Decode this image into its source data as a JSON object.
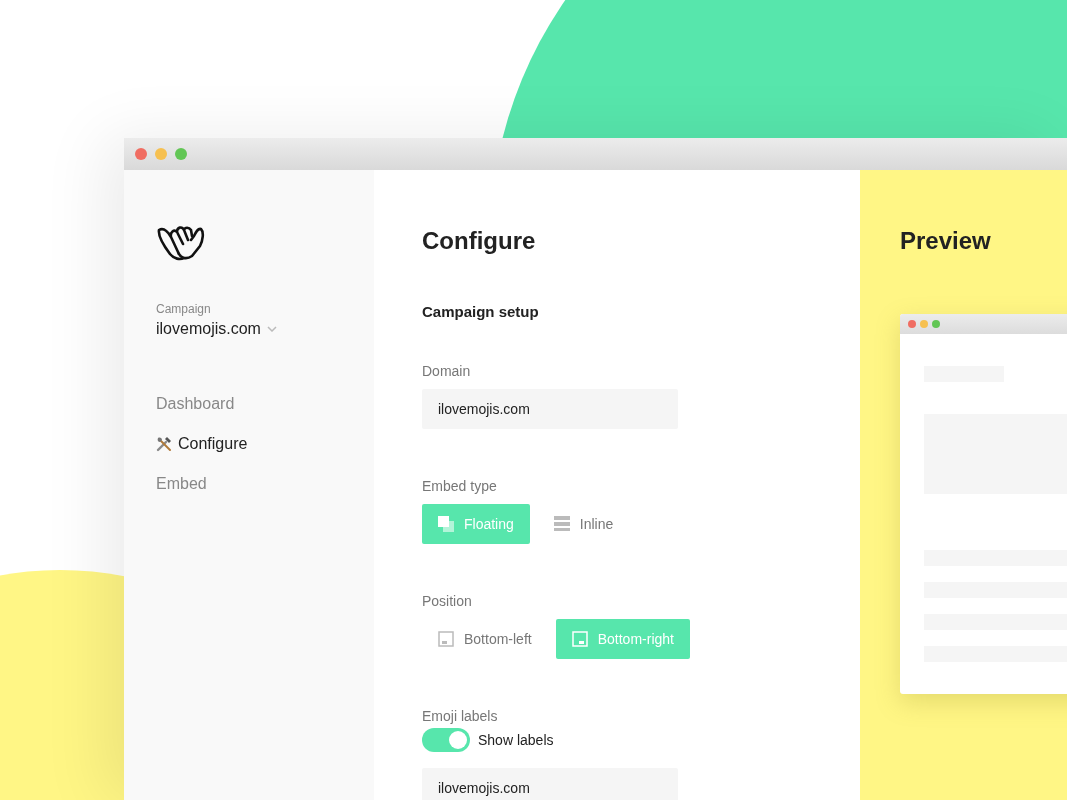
{
  "sidebar": {
    "campaign": {
      "label": "Campaign",
      "value": "ilovemojis.com"
    },
    "nav": [
      {
        "label": "Dashboard",
        "selected": false
      },
      {
        "label": "Configure",
        "selected": true
      },
      {
        "label": "Embed",
        "selected": false
      }
    ]
  },
  "configure": {
    "title": "Configure",
    "section_title": "Campaign setup",
    "domain": {
      "label": "Domain",
      "value": "ilovemojis.com"
    },
    "embed_type": {
      "label": "Embed type",
      "options": [
        {
          "label": "Floating",
          "selected": true
        },
        {
          "label": "Inline",
          "selected": false
        }
      ]
    },
    "position": {
      "label": "Position",
      "options": [
        {
          "label": "Bottom-left",
          "selected": false
        },
        {
          "label": "Bottom-right",
          "selected": true
        }
      ]
    },
    "emoji_labels": {
      "label": "Emoji labels",
      "toggle": {
        "label": "Show labels",
        "on": true
      },
      "value": "ilovemojis.com"
    }
  },
  "preview": {
    "title": "Preview"
  }
}
